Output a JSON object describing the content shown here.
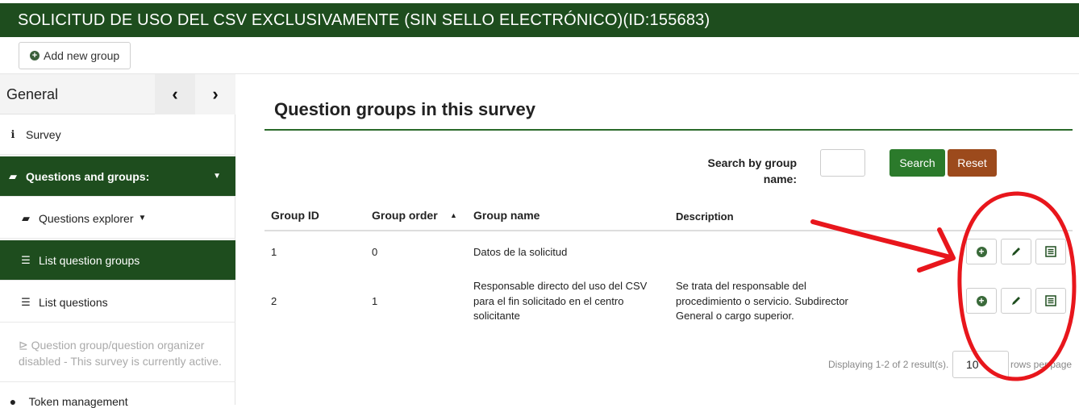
{
  "header": {
    "title": "SOLICITUD DE USO DEL CSV EXCLUSIVAMENTE (SIN SELLO ELECTRÓNICO)(ID:155683)"
  },
  "toolbar": {
    "add_group_label": "Add new group",
    "add_group_icon": "plus-circle-icon"
  },
  "sidebar": {
    "title": "General",
    "prev_glyph": "‹",
    "next_glyph": "›",
    "items": [
      {
        "label": "Survey",
        "icon": "info-icon",
        "glyph": "ℹ"
      },
      {
        "label": "Questions and groups:",
        "icon": "folder-open-icon",
        "glyph": "▰",
        "caret": "▼"
      },
      {
        "label": "Questions explorer",
        "icon": "folder-open-icon",
        "glyph": "▰",
        "caret": "▼"
      },
      {
        "label": "List question groups",
        "icon": "list-icon",
        "glyph": "☰"
      },
      {
        "label": "List questions",
        "icon": "list-icon",
        "glyph": "☰"
      }
    ],
    "organizer_note": "Question group/question organizer disabled - This survey is currently active.",
    "organizer_icon": "organizer-icon",
    "token_label": "Token management",
    "token_icon": "user-icon"
  },
  "main": {
    "title": "Question groups in this survey",
    "search_label": "Search by group name:",
    "search_value": "",
    "search_button": "Search",
    "reset_button": "Reset",
    "columns": [
      "Group ID",
      "Group order",
      "Group name",
      "Description"
    ],
    "sort_glyph": "▲",
    "rows": [
      {
        "id": "1",
        "order": "0",
        "name": "Datos de la solicitud",
        "description": ""
      },
      {
        "id": "2",
        "order": "1",
        "name": "Responsable directo del uso del CSV para el fin solicitado en el centro solicitante",
        "description": "Se trata del responsable del procedimiento o servicio. Subdirector General o cargo superior."
      }
    ],
    "row_actions": [
      "add-question-icon",
      "edit-icon",
      "summary-icon"
    ],
    "displaying_text": "Displaying 1-2 of 2 result(s).",
    "page_size": "10",
    "rows_per_page_label": "rows per page"
  },
  "colors": {
    "brand_green": "#1e4d1e",
    "search_green": "#2b7a2b",
    "reset_brown": "#9c4a1c",
    "annotation_red": "#e8161c"
  }
}
